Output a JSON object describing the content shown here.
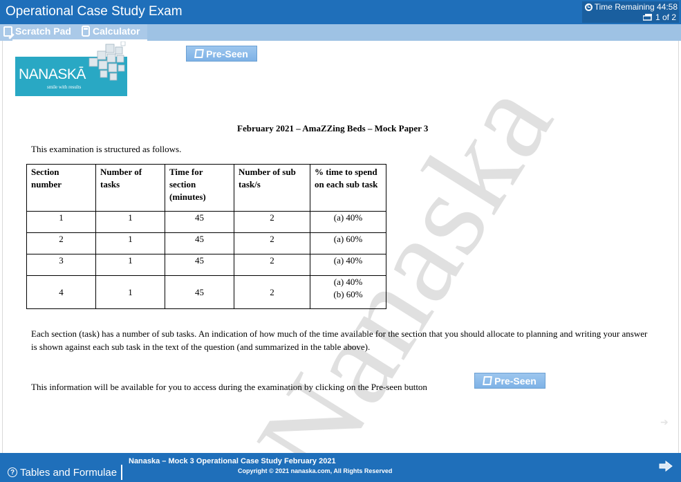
{
  "window": {
    "title": "Operational Case Study Exam"
  },
  "timer": {
    "label": "Time Remaining 44:58",
    "page_indicator": "1 of 2"
  },
  "toolbar": {
    "scratch_pad": "Scratch Pad",
    "calculator": "Calculator"
  },
  "logo": {
    "name": "NANASKĀ",
    "tagline": "smile with results"
  },
  "buttons": {
    "preseen_top": "Pre-Seen",
    "preseen_inline": "Pre-Seen"
  },
  "content": {
    "heading": "February 2021 – AmaZZing Beds – Mock Paper 3",
    "intro": "This examination is structured as follows.",
    "table": {
      "headers": [
        "Section number",
        "Number of tasks",
        "Time for section (minutes)",
        "Number of sub task/s",
        "% time to spend on each sub task"
      ],
      "rows": [
        [
          "1",
          "1",
          "45",
          "2",
          "(a) 40%",
          ""
        ],
        [
          "2",
          "1",
          "45",
          "2",
          "(a) 60%",
          ""
        ],
        [
          "3",
          "1",
          "45",
          "2",
          "(a) 40%",
          ""
        ],
        [
          "4",
          "1",
          "45",
          "2",
          "(a) 40%",
          "(b) 60%"
        ]
      ]
    },
    "paragraph": "Each section (task) has a number of sub tasks. An indication of how much of the time available for the section that you should allocate to planning and writing your answer is shown against each sub task in the text of the question (and summarized in the table above).",
    "info": "This information will be available for you to access during the examination by clicking on the Pre-seen button"
  },
  "watermark": "Nanaska",
  "footer": {
    "tables_button": "Tables and Formulae",
    "line1": "Nanaska – Mock 3 Operational Case Study February 2021",
    "line2": "Copyright © 2021 nanaska.com, All Rights Reserved"
  },
  "colors": {
    "titlebar": "#1f6fba",
    "toolbar": "#9ec2e4",
    "button": "#8ebce9",
    "logo_bg": "#29a8c4"
  },
  "icons": {
    "timer": "clock-icon",
    "pages": "pages-icon",
    "scratch": "scratch-pad-icon",
    "calc": "calculator-icon",
    "preseen": "folder-icon",
    "help": "help-circle-icon",
    "next": "arrow-right-icon"
  }
}
